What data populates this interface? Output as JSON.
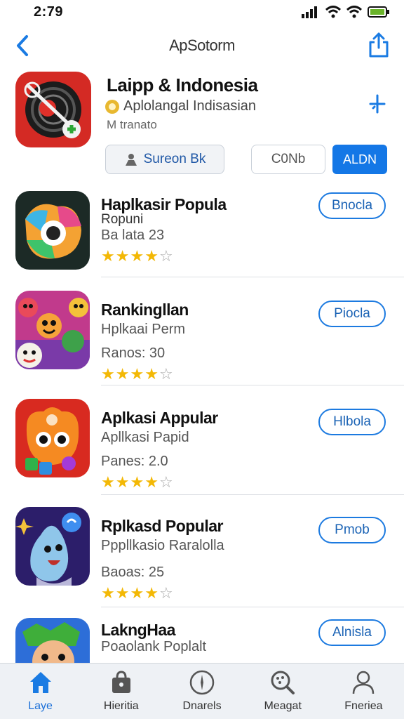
{
  "status_bar": {
    "time": "2:79"
  },
  "nav": {
    "title": "ApSotorm"
  },
  "featured": {
    "title": "Laipp & Indonesia",
    "subtitle": "Aplolangal Indisasian",
    "developer": "M tranato",
    "secondary_button": "Sureon Bk",
    "outline_button": "C0Nb",
    "primary_button": "ALDN"
  },
  "apps": [
    {
      "name": "Haplkasir Popula",
      "name_line2": "Ropuni",
      "subtitle": "Ba lata 23",
      "meta": "",
      "rating": 4,
      "button": "Bnocla"
    },
    {
      "name": "Rankingllan",
      "subtitle": "Hplkaai Perm",
      "meta": "Ranos: 30",
      "rating": 4,
      "button": "Piocla"
    },
    {
      "name": "Aplkasi Appular",
      "subtitle": "Apllkasi Papid",
      "meta": "Panes: 2.0",
      "rating": 4,
      "button": "Hlbola"
    },
    {
      "name": "Rplkasd Popular",
      "subtitle": "Pppllkasio Raralolla",
      "meta": "Baoas: 25",
      "rating": 4,
      "button": "Pmob"
    },
    {
      "name": "LakngHaa",
      "subtitle": "Poaolank Poplalt",
      "meta": "",
      "rating": 0,
      "button": "Alnisla"
    }
  ],
  "tabs": [
    {
      "label": "Laye",
      "icon": "home-icon",
      "active": true
    },
    {
      "label": "Hieritia",
      "icon": "bag-icon",
      "active": false
    },
    {
      "label": "Dnarels",
      "icon": "compass-icon",
      "active": false
    },
    {
      "label": "Meagat",
      "icon": "search-icon",
      "active": false
    },
    {
      "label": "Fneriea",
      "icon": "person-icon",
      "active": false
    }
  ],
  "colors": {
    "accent": "#1477e6",
    "star": "#f3b805"
  }
}
